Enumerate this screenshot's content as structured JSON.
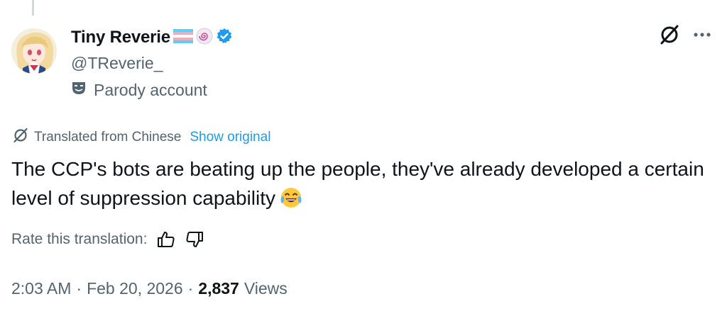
{
  "author": {
    "display_name": "Tiny Reverie",
    "handle": "@TReverie_",
    "account_label": "Parody account",
    "flag_colors": [
      "#5bcefa",
      "#f5a9b8",
      "#ffffff",
      "#f5a9b8",
      "#5bcefa"
    ],
    "verified_color": "#1d9bf0",
    "badge_icon": "lollipop-icon"
  },
  "translation": {
    "label": "Translated from Chinese",
    "show_original": "Show original",
    "rate_label": "Rate this translation:"
  },
  "tweet": {
    "text": "The CCP's bots are beating up the people, they've already developed a certain level of suppression capability",
    "emoji": "tears-of-joy-icon"
  },
  "meta": {
    "time": "2:03 AM",
    "separator1": "·",
    "date": "Feb 20, 2026",
    "separator2": "·",
    "views_count": "2,837",
    "views_label": "Views"
  },
  "colors": {
    "text": "#0f1419",
    "secondary": "#536471",
    "link": "#1d9bf0"
  }
}
